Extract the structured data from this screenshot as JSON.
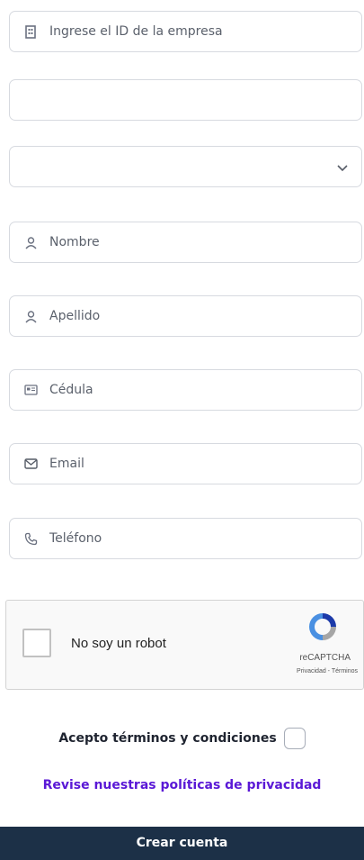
{
  "form": {
    "company_id_placeholder": "Ingrese el ID de la empresa",
    "blank_field_value": "",
    "select_value": "",
    "first_name_placeholder": "Nombre",
    "last_name_placeholder": "Apellido",
    "id_card_placeholder": "Cédula",
    "email_placeholder": "Email",
    "phone_placeholder": "Teléfono"
  },
  "captcha": {
    "label": "No soy un robot",
    "brand": "reCAPTCHA",
    "links": "Privacidad - Términos"
  },
  "terms_label": "Acepto términos y condiciones",
  "privacy_link": "Revise nuestras políticas de privacidad",
  "submit_label": "Crear cuenta",
  "colors": {
    "accent": "#5a18d6",
    "button": "#1c3047",
    "border": "#d7dae0"
  },
  "icons": [
    "building-icon",
    "chevron-down-icon",
    "user-icon",
    "id-card-icon",
    "mail-icon",
    "phone-icon",
    "recaptcha-logo-icon"
  ]
}
